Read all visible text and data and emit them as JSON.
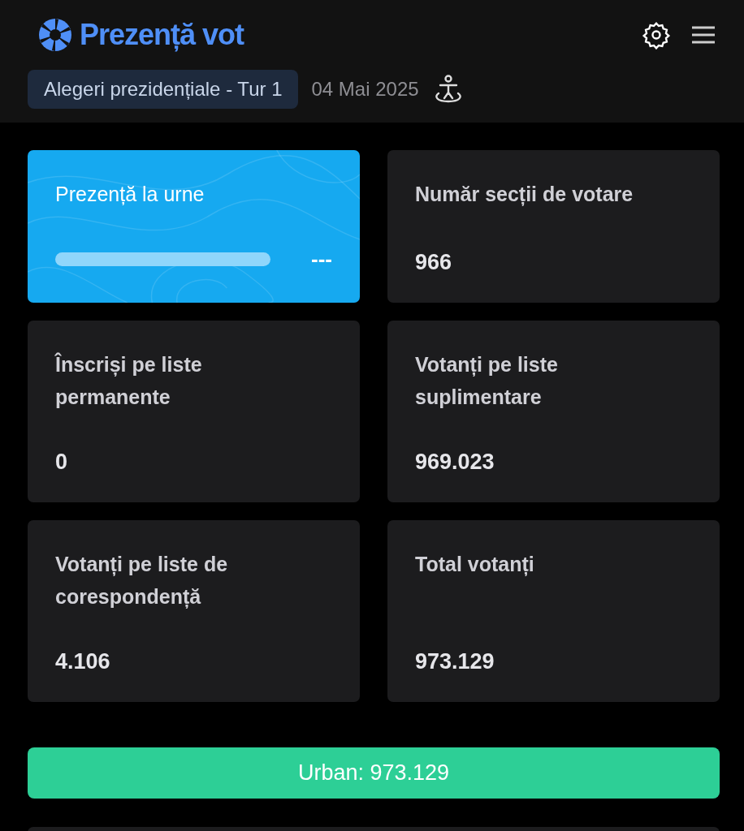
{
  "header": {
    "title": "Prezență vot",
    "election": "Alegeri prezidențiale - Tur 1",
    "date": "04 Mai 2025"
  },
  "turnout": {
    "label": "Prezență la urne",
    "level": 0,
    "reading": "---"
  },
  "stats": [
    {
      "label": "Număr secții de votare",
      "value": "966"
    },
    {
      "label": "Înscriși pe liste permanente",
      "value": "0"
    },
    {
      "label": "Votanți pe liste suplimentare",
      "value": "969.023"
    },
    {
      "label": "Votanți pe liste de corespondență",
      "value": "4.106"
    },
    {
      "label": "Total votanți",
      "value": "973.129"
    }
  ],
  "area_bar": {
    "text": "Urban: 973.129"
  }
}
